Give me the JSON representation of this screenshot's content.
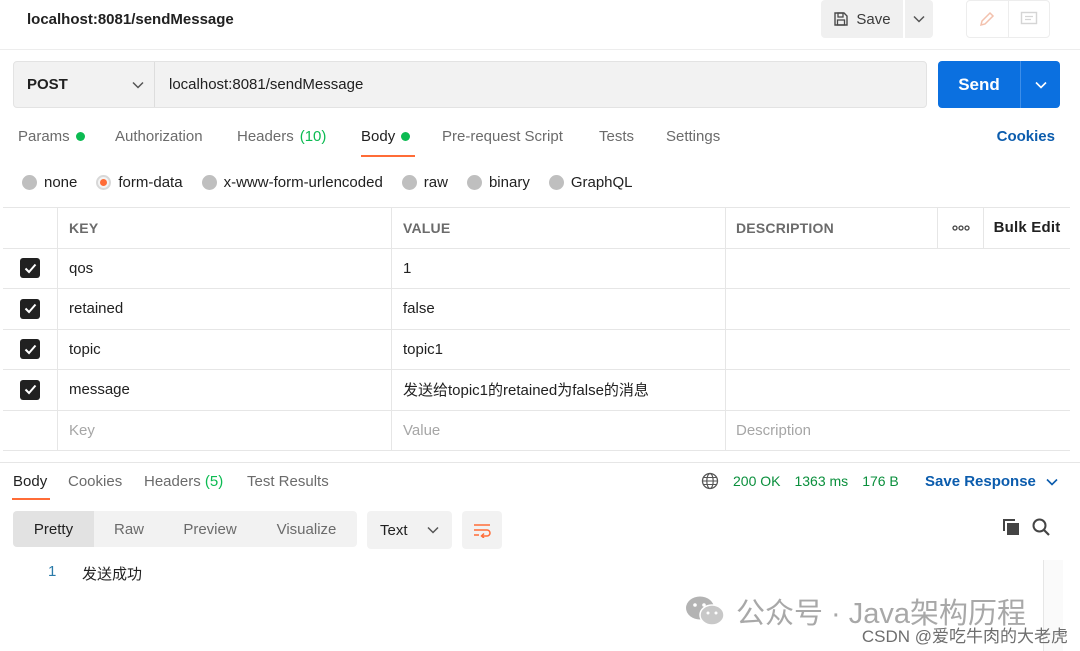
{
  "request": {
    "title": "localhost:8081/sendMessage",
    "save_label": "Save",
    "method": "POST",
    "url": "localhost:8081/sendMessage",
    "send_label": "Send"
  },
  "request_tabs": [
    {
      "label": "Params",
      "badge_dot": true
    },
    {
      "label": "Authorization"
    },
    {
      "label": "Headers",
      "count": "(10)"
    },
    {
      "label": "Body",
      "badge_dot": true,
      "active": true
    },
    {
      "label": "Pre-request Script"
    },
    {
      "label": "Tests"
    },
    {
      "label": "Settings"
    }
  ],
  "cookies_label": "Cookies",
  "body_types": [
    {
      "label": "none",
      "selected": false
    },
    {
      "label": "form-data",
      "selected": true
    },
    {
      "label": "x-www-form-urlencoded",
      "selected": false
    },
    {
      "label": "raw",
      "selected": false
    },
    {
      "label": "binary",
      "selected": false
    },
    {
      "label": "GraphQL",
      "selected": false
    }
  ],
  "table": {
    "headers": {
      "key": "KEY",
      "value": "VALUE",
      "description": "DESCRIPTION",
      "bulk_edit": "Bulk Edit"
    },
    "rows": [
      {
        "checked": true,
        "key": "qos",
        "value": "1",
        "description": ""
      },
      {
        "checked": true,
        "key": "retained",
        "value": "false",
        "description": ""
      },
      {
        "checked": true,
        "key": "topic",
        "value": "topic1",
        "description": ""
      },
      {
        "checked": true,
        "key": "message",
        "value": "发送给topic1的retained为false的消息",
        "description": ""
      }
    ],
    "placeholders": {
      "key": "Key",
      "value": "Value",
      "description": "Description"
    }
  },
  "response": {
    "tabs": [
      {
        "label": "Body",
        "active": true
      },
      {
        "label": "Cookies"
      },
      {
        "label": "Headers",
        "count": "(5)"
      },
      {
        "label": "Test Results"
      }
    ],
    "status": "200 OK",
    "time": "1363 ms",
    "size": "176 B",
    "save_response_label": "Save Response",
    "view_tabs": [
      "Pretty",
      "Raw",
      "Preview",
      "Visualize"
    ],
    "format": "Text",
    "lines": [
      {
        "number": "1",
        "text": "发送成功"
      }
    ]
  },
  "watermark": {
    "main": "公众号 · Java架构历程",
    "csdn": "CSDN @爱吃牛肉的大老虎"
  },
  "colors": {
    "accent_orange": "#ff6c37",
    "send_blue": "#0b70e0",
    "link_blue": "#0b5cad",
    "status_green": "#0a8f3c"
  }
}
